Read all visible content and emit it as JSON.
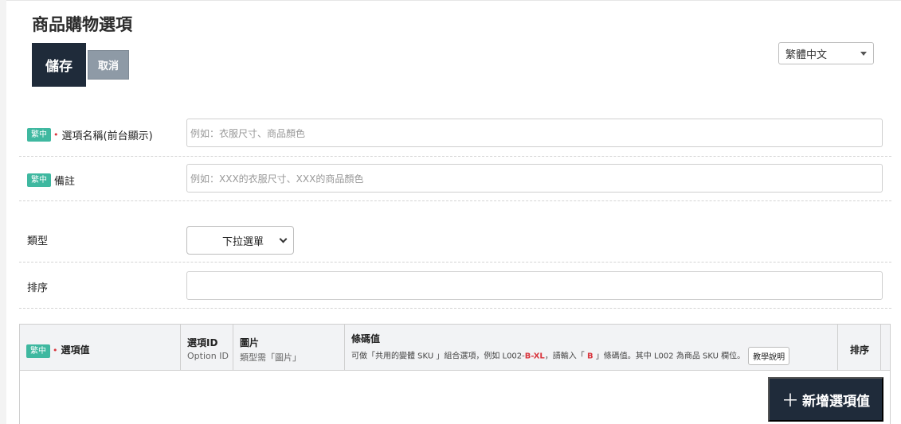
{
  "page": {
    "title": "商品購物選項",
    "save_label": "儲存",
    "cancel_label": "取消",
    "language": "繁體中文"
  },
  "form": {
    "lang_badge": "繁中",
    "required_mark": "•",
    "option_name": {
      "label": "選項名稱(前台顯示)",
      "placeholder": "例如：衣服尺寸、商品顏色",
      "value": ""
    },
    "note": {
      "label": "備註",
      "placeholder": "例如：XXX的衣服尺寸、XXX的商品顏色",
      "value": ""
    },
    "type": {
      "label": "類型",
      "selected": "下拉選單"
    },
    "sort": {
      "label": "排序",
      "value": ""
    }
  },
  "table": {
    "columns": {
      "option_value": "選項值",
      "option_id": "選項ID",
      "option_id_sub": "Option ID",
      "image": "圖片",
      "image_sub": "類型需「圖片」",
      "barcode": "條碼值",
      "barcode_hint_1": "可做「共用的變體 SKU 」組合選項，例如 L002-",
      "barcode_hint_red1": "B-XL",
      "barcode_hint_2": "，請輸入「 ",
      "barcode_hint_red2": "B",
      "barcode_hint_3": " 」條碼值。其中 L002 為商品 SKU 欄位。",
      "tutorial_label": "教學說明",
      "sort": "排序"
    },
    "rows": []
  },
  "actions": {
    "add_option_label": "新增選項值"
  },
  "colors": {
    "primary_dark": "#1f2b3a",
    "cancel_gray": "#8e9aa6",
    "badge_teal": "#3fb8a0",
    "required_red": "#d9363e"
  }
}
